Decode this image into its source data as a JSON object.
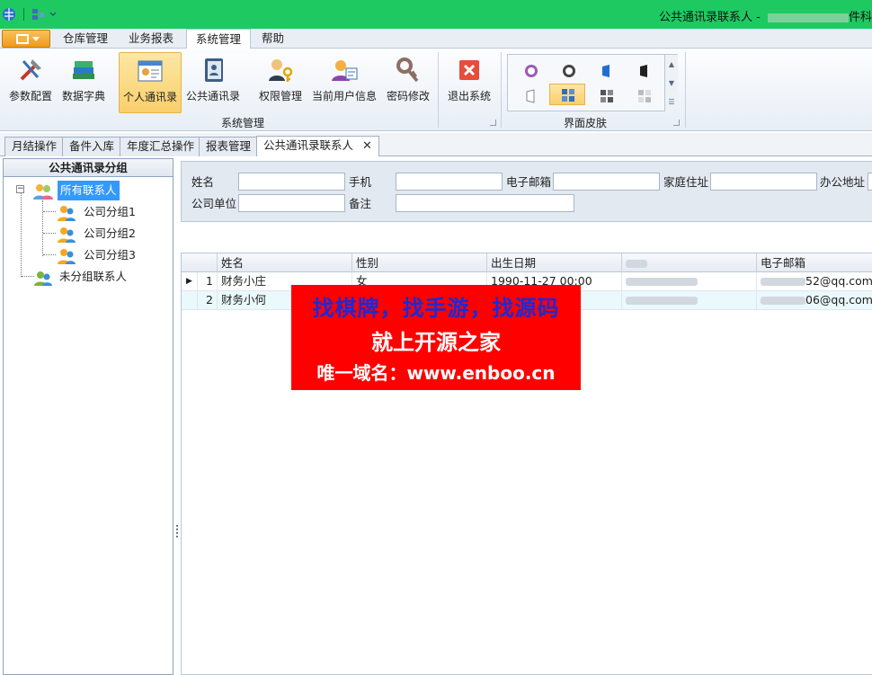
{
  "window": {
    "title": "公共通讯录联系人 - ",
    "title_suffix": "件科"
  },
  "ribbon_tabs": [
    {
      "label": "仓库管理"
    },
    {
      "label": "业务报表"
    },
    {
      "label": "系统管理",
      "active": true
    },
    {
      "label": "帮助"
    }
  ],
  "ribbon": {
    "buttons": [
      {
        "label": "参数配置",
        "icon": "tools-icon"
      },
      {
        "label": "数据字典",
        "icon": "books-icon"
      },
      {
        "label": "个人通讯录",
        "icon": "contact-card-icon",
        "selected": true
      },
      {
        "label": "公共通讯录",
        "icon": "address-book-icon"
      },
      {
        "label": "权限管理",
        "icon": "users-key-icon"
      },
      {
        "label": "当前用户信息",
        "icon": "user-info-icon"
      },
      {
        "label": "密码修改",
        "icon": "password-key-icon"
      },
      {
        "label": "退出系统",
        "icon": "exit-icon"
      }
    ],
    "group_system": "系统管理",
    "group_skin": "界面皮肤"
  },
  "doc_tabs": [
    {
      "label": "月结操作"
    },
    {
      "label": "备件入库"
    },
    {
      "label": "年度汇总操作"
    },
    {
      "label": "报表管理"
    },
    {
      "label": "公共通讯录联系人",
      "active": true,
      "close": "✕"
    }
  ],
  "left_panel": {
    "header": "公共通讯录分组",
    "tree": {
      "root": "所有联系人",
      "children": [
        "公司分组1",
        "公司分组2",
        "公司分组3"
      ],
      "ungrouped": "未分组联系人"
    }
  },
  "search_form": {
    "name_label": "姓名",
    "mobile_label": "手机",
    "email_label": "电子邮箱",
    "home_address_label": "家庭住址",
    "office_address_label": "办公地址",
    "company_label": "公司单位",
    "remark_label": "备注",
    "name_value": "",
    "mobile_value": "",
    "email_value": "",
    "home_address_value": "",
    "company_value": "",
    "remark_value": ""
  },
  "grid": {
    "columns": [
      "姓名",
      "性别",
      "出生日期",
      "电子邮箱"
    ],
    "rows": [
      {
        "num": "1",
        "name": "财务小庄",
        "gender": "女",
        "birth": "1990-11-27 00:00",
        "email": "52@qq.com",
        "current": true
      },
      {
        "num": "2",
        "name": "财务小何",
        "gender": "",
        "birth": "",
        "email": "06@qq.com"
      }
    ]
  },
  "banner": {
    "line1": "找棋牌，找手游，找源码",
    "line2": "就上开源之家",
    "line3": "唯一域名：www.enboo.cn"
  },
  "colors": {
    "titlebar": "#1fc961",
    "selection": "#3399ff",
    "ribbon_selected": "#f9cf6b",
    "banner_bg": "#ff0000",
    "banner_line1": "#1b2ad8"
  }
}
